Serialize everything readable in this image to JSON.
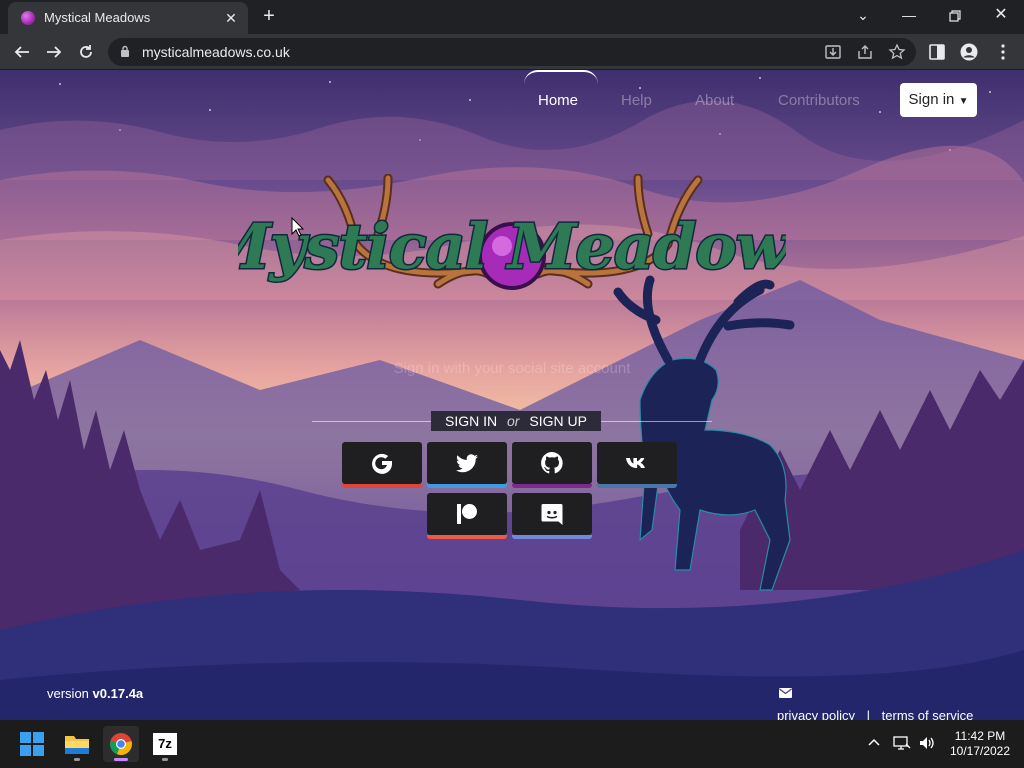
{
  "browser": {
    "tab_title": "Mystical Meadows",
    "url": "mysticalmeadows.co.uk"
  },
  "nav": {
    "home": "Home",
    "help": "Help",
    "about": "About",
    "contributors": "Contributors",
    "sign_in": "Sign in"
  },
  "hero": {
    "logo_text": "Mystical Meadows",
    "subtitle": "Sign in with your social site account",
    "sign_in": "SIGN IN",
    "or": "or",
    "sign_up": "SIGN UP"
  },
  "social_buttons": [
    {
      "name": "google",
      "color": "#e0453a"
    },
    {
      "name": "twitter",
      "color": "#3f9ae0"
    },
    {
      "name": "github",
      "color": "#7d2a8e"
    },
    {
      "name": "vk",
      "color": "#4a76a8"
    },
    {
      "name": "patreon",
      "color": "#e85b46"
    },
    {
      "name": "discord",
      "color": "#7289da"
    }
  ],
  "footer": {
    "version_label": "version",
    "version": "v0.17.4a",
    "privacy": "privacy policy",
    "separator": "|",
    "terms": "terms of service"
  },
  "taskbar": {
    "time": "11:42 PM",
    "date": "10/17/2022",
    "sevenzip_label": "7z"
  }
}
